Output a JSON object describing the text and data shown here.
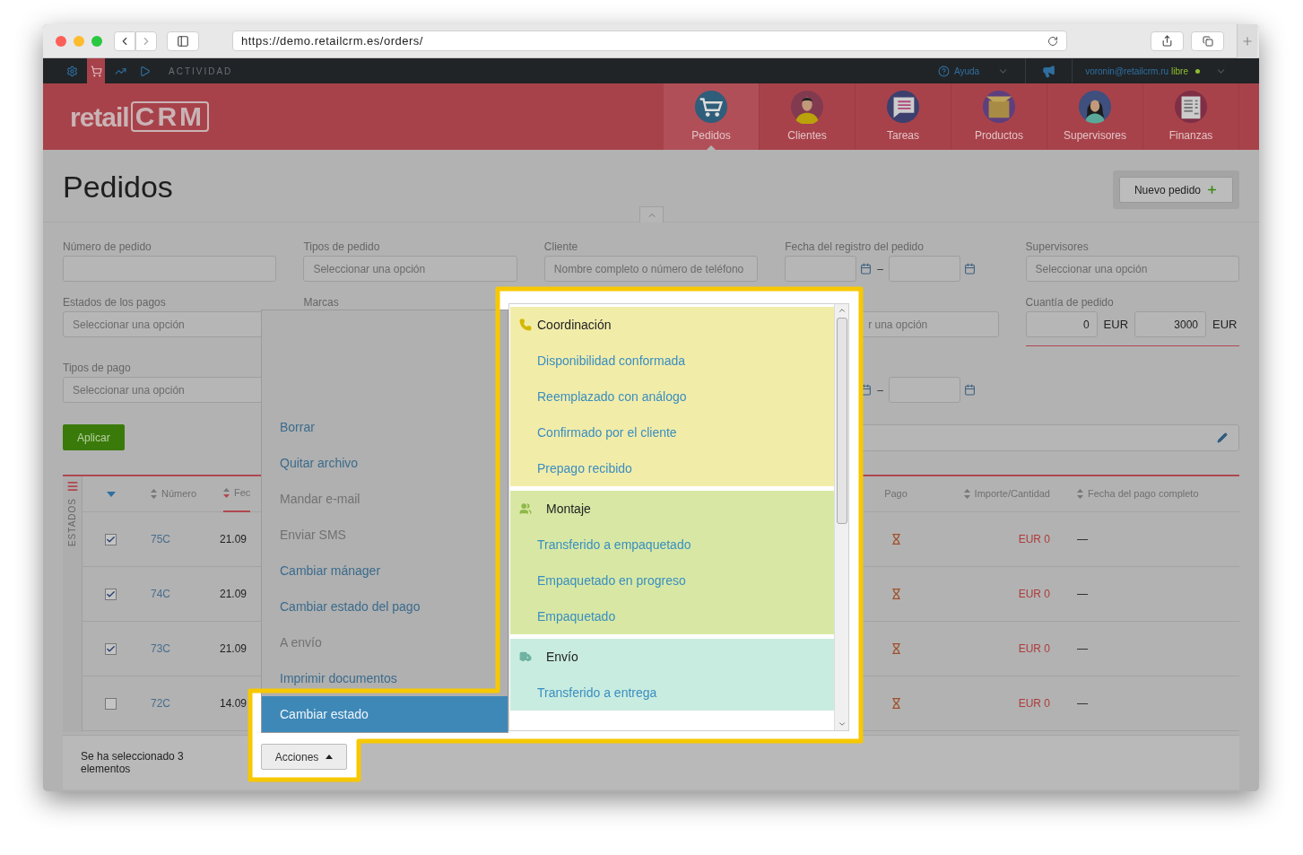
{
  "browser": {
    "url": "https://demo.retailcrm.es/orders/"
  },
  "topbar": {
    "tools": [
      {
        "selected": false
      },
      {
        "selected": true
      },
      {
        "selected": false
      },
      {
        "selected": false
      }
    ],
    "section": "ACTIVIDAD",
    "help": "Ayuda",
    "user": "voronin@retailcrm.ru",
    "plan": "libre"
  },
  "header": {
    "logo": {
      "text": "retail",
      "mark": "CRM"
    },
    "nav": [
      {
        "label": "Pedidos",
        "selected": true
      },
      {
        "label": "Clientes",
        "selected": false
      },
      {
        "label": "Tareas",
        "selected": false
      },
      {
        "label": "Productos",
        "selected": false
      },
      {
        "label": "Supervisores",
        "selected": false
      },
      {
        "label": "Finanzas",
        "selected": false
      }
    ]
  },
  "page": {
    "title": "Pedidos",
    "new_button": "Nuevo pedido"
  },
  "filters": {
    "order_number": {
      "label": "Número de pedido"
    },
    "order_types": {
      "label": "Tipos de pedido",
      "placeholder": "Seleccionar una opción"
    },
    "client": {
      "label": "Cliente",
      "placeholder": "Nombre completo o número de teléfono"
    },
    "registration_date": {
      "label": "Fecha del registro del pedido",
      "separator": "–"
    },
    "managers": {
      "label": "Supervisores",
      "placeholder": "Seleccionar una opción"
    },
    "payment_statuses": {
      "label": "Estados de los pagos",
      "placeholder": "Seleccionar una opción"
    },
    "brands": {
      "label": "Marcas"
    },
    "stores": {
      "placeholder": "r una opción"
    },
    "order_amount": {
      "label": "Cuantía de pedido",
      "from": "0",
      "from_currency": "EUR",
      "to": "3000",
      "to_currency": "EUR"
    },
    "payment_types": {
      "label": "Tipos de pago",
      "placeholder": "Seleccionar una opción"
    },
    "payment_date": {
      "separator": "–"
    },
    "apply_button": "Aplicar"
  },
  "table": {
    "side_label": "ESTADOS",
    "columns": [
      {
        "label": "Número",
        "sortable": true,
        "sorted": false
      },
      {
        "label": "Fec",
        "sortable": true,
        "sorted": true
      },
      {
        "label": "Pago",
        "sortable": false,
        "sorted": false
      },
      {
        "label": "Importe/Cantidad",
        "sortable": true,
        "sorted": false
      },
      {
        "label": "Fecha del pago completo",
        "sortable": true,
        "sorted": false
      }
    ],
    "rows": [
      {
        "checked": true,
        "number": "75C",
        "date": "21.09",
        "amount": "EUR 0",
        "paid_date": "—"
      },
      {
        "checked": true,
        "number": "74C",
        "date": "21.09",
        "amount": "EUR 0",
        "paid_date": "—"
      },
      {
        "checked": true,
        "number": "73C",
        "date": "21.09",
        "amount": "EUR 0",
        "paid_date": "—"
      },
      {
        "checked": false,
        "number": "72C",
        "date": "14.09",
        "amount": "EUR 0",
        "paid_date": "—"
      }
    ]
  },
  "selection": {
    "text": "Se ha seleccionado 3 elementos",
    "actions_button": "Acciones"
  },
  "actions_menu": [
    {
      "label": "Borrar",
      "disabled": false,
      "selected": false
    },
    {
      "label": "Quitar archivo",
      "disabled": false,
      "selected": false
    },
    {
      "label": "Mandar e-mail",
      "disabled": true,
      "selected": false
    },
    {
      "label": "Enviar SMS",
      "disabled": true,
      "selected": false
    },
    {
      "label": "Cambiar mánager",
      "disabled": false,
      "selected": false
    },
    {
      "label": "Cambiar estado del pago",
      "disabled": false,
      "selected": false
    },
    {
      "label": "A envío",
      "disabled": true,
      "selected": false
    },
    {
      "label": "Imprimir documentos",
      "disabled": false,
      "selected": false
    },
    {
      "label": "Cambiar estado",
      "disabled": false,
      "selected": true
    }
  ],
  "status_menu": [
    {
      "name": "Coordinación",
      "color": "#f2eca9",
      "statuses": [
        "Disponibilidad conformada",
        "Reemplazado con análogo",
        "Confirmado por el cliente",
        "Prepago recibido"
      ]
    },
    {
      "name": "Montaje",
      "color": "#d8e8a4",
      "statuses": [
        "Transferido a empaquetado",
        "Empaquetado en progreso",
        "Empaquetado"
      ]
    },
    {
      "name": "Envío",
      "color": "#c9ece0",
      "statuses": [
        "Transferido a entrega"
      ]
    }
  ]
}
